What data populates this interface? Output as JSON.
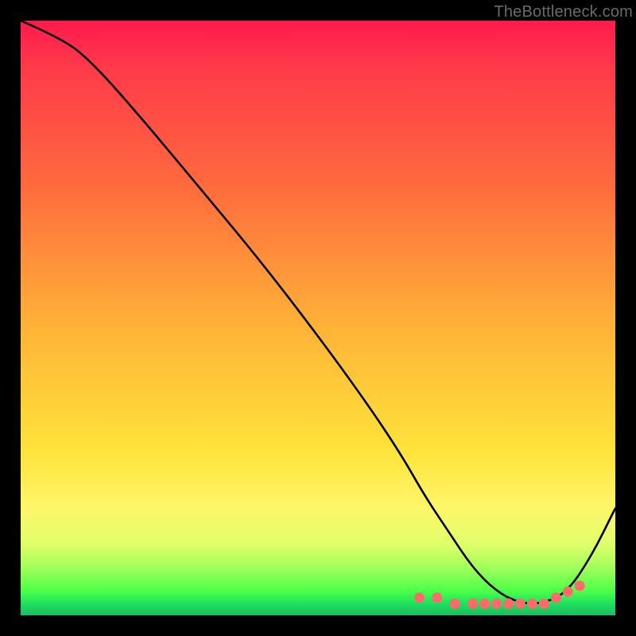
{
  "watermark": "TheBottleneck.com",
  "chart_data": {
    "type": "line",
    "title": "",
    "xlabel": "",
    "ylabel": "",
    "xlim": [
      0,
      100
    ],
    "ylim": [
      0,
      100
    ],
    "legend": false,
    "series": [
      {
        "name": "curve",
        "x": [
          0,
          7,
          12,
          20,
          30,
          40,
          50,
          58,
          64,
          68,
          72,
          76,
          80,
          84,
          88,
          92,
          96,
          100
        ],
        "y": [
          100,
          97,
          93,
          84,
          72,
          60,
          47,
          36,
          27,
          20,
          14,
          8,
          4,
          2,
          2,
          4,
          10,
          18
        ]
      }
    ],
    "markers": {
      "name": "threshold-dots",
      "x": [
        67,
        70,
        73,
        76,
        78,
        80,
        82,
        84,
        86,
        88,
        90,
        92,
        94
      ],
      "y": [
        3,
        3,
        2,
        2,
        2,
        2,
        2,
        2,
        2,
        2,
        3,
        4,
        5
      ]
    },
    "gradient_stops": [
      {
        "pos": 0.0,
        "color": "#ff1a4d"
      },
      {
        "pos": 0.28,
        "color": "#ff6b3d"
      },
      {
        "pos": 0.52,
        "color": "#ffb438"
      },
      {
        "pos": 0.72,
        "color": "#ffe23a"
      },
      {
        "pos": 0.88,
        "color": "#dfff6a"
      },
      {
        "pos": 1.0,
        "color": "#1abc60"
      }
    ]
  }
}
